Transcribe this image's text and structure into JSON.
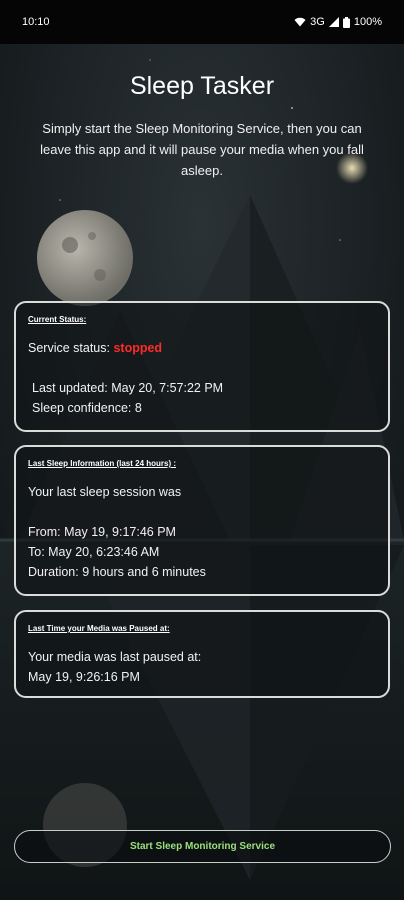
{
  "status_bar": {
    "time": "10:10",
    "network": "3G",
    "battery": "100%"
  },
  "app": {
    "title": "Sleep Tasker",
    "description": "Simply start the Sleep Monitoring Service, then you can leave this app and it will pause your media when you fall asleep."
  },
  "current_status": {
    "heading": "Current Status:",
    "service_label": "Service status: ",
    "service_value": "stopped",
    "last_updated": "Last updated: May 20, 7:57:22 PM",
    "sleep_confidence": "Sleep confidence: 8"
  },
  "last_sleep": {
    "heading": "Last Sleep Information (last 24 hours) :",
    "intro": "Your last sleep session was",
    "from": "From: May 19, 9:17:46 PM",
    "to": "To: May 20, 6:23:46 AM",
    "duration": "Duration: 9 hours and 6 minutes"
  },
  "media_paused": {
    "heading": "Last Time your Media was Paused at:",
    "intro": "Your media was last paused at:",
    "time": "May 19, 9:26:16 PM"
  },
  "start_button": {
    "label": "Start Sleep Monitoring Service"
  },
  "colors": {
    "status_stopped": "#ff2a2a",
    "button_text": "#9be07a",
    "card_border": "#d9dcd8"
  }
}
